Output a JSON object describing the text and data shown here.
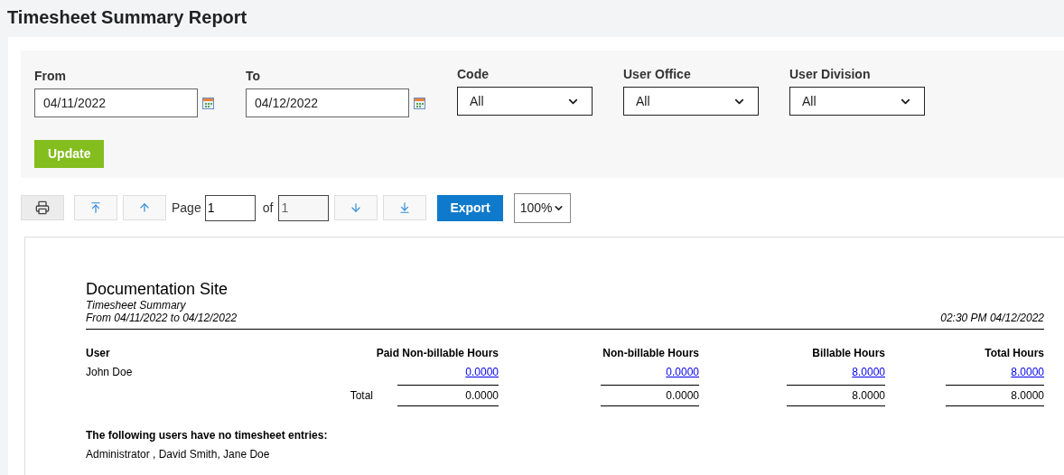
{
  "page_title": "Timesheet Summary Report",
  "filters": [
    {
      "kind": "date",
      "label": "From",
      "value": "04/11/2022"
    },
    {
      "kind": "date",
      "label": "To",
      "value": "04/12/2022"
    },
    {
      "kind": "select",
      "label": "Code",
      "value": "All"
    },
    {
      "kind": "select",
      "label": "User Office",
      "value": "All"
    },
    {
      "kind": "select",
      "label": "User Division",
      "value": "All"
    }
  ],
  "update_button": "Update",
  "toolbar": {
    "page_label": "Page",
    "page_value": "1",
    "of_label": "of",
    "page_count": "1",
    "export_button": "Export",
    "zoom": "100%"
  },
  "report": {
    "site": "Documentation Site",
    "subtitle": "Timesheet Summary",
    "range": "From 04/11/2022 to 04/12/2022",
    "generated": "02:30 PM 04/12/2022",
    "columns": [
      "User",
      "Paid Non-billable Hours",
      "Non-billable Hours",
      "Billable Hours",
      "Total Hours"
    ],
    "rows": [
      {
        "user": "John Doe",
        "values": [
          "0.0000",
          "0.0000",
          "8.0000",
          "8.0000"
        ]
      }
    ],
    "total_label": "Total",
    "totals": [
      "0.0000",
      "0.0000",
      "8.0000",
      "8.0000"
    ],
    "no_entries_heading": "The following users have no timesheet entries:",
    "no_entries_users": "Administrator , David Smith, Jane Doe"
  }
}
